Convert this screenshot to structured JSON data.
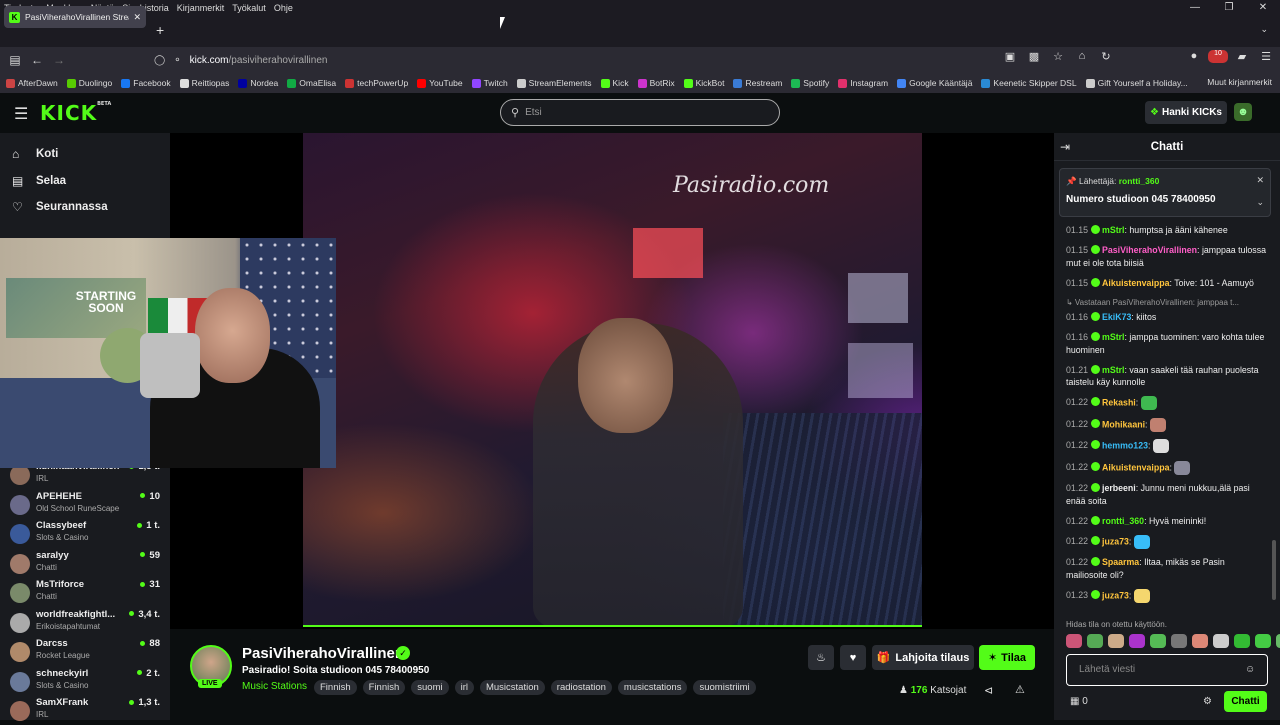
{
  "browser": {
    "menu": [
      "Tiedosto",
      "Muokkaa",
      "Näytä",
      "Sivuhistoria",
      "Kirjanmerkit",
      "Työkalut",
      "Ohje"
    ],
    "tab_title": "PasiViherahoVirallinen Stream",
    "url_host": "kick.com",
    "url_path": "/pasiviherahovirallinen",
    "badge_count": "10",
    "bookmarks": [
      {
        "label": "AfterDawn",
        "color": "#c44"
      },
      {
        "label": "Duolingo",
        "color": "#58cc02"
      },
      {
        "label": "Facebook",
        "color": "#1877f2"
      },
      {
        "label": "Reittiopas",
        "color": "#ddd"
      },
      {
        "label": "Nordea",
        "color": "#0000a0"
      },
      {
        "label": "OmaElisa",
        "color": "#1a4"
      },
      {
        "label": "techPowerUp",
        "color": "#c33"
      },
      {
        "label": "YouTube",
        "color": "#f00"
      },
      {
        "label": "Twitch",
        "color": "#9146ff"
      },
      {
        "label": "StreamElements",
        "color": "#ccc"
      },
      {
        "label": "Kick",
        "color": "#53fc18"
      },
      {
        "label": "BotRix",
        "color": "#c3c"
      },
      {
        "label": "KickBot",
        "color": "#53fc18"
      },
      {
        "label": "Restream",
        "color": "#3a7bd5"
      },
      {
        "label": "Spotify",
        "color": "#1db954"
      },
      {
        "label": "Instagram",
        "color": "#e1306c"
      },
      {
        "label": "Google Kääntäjä",
        "color": "#4285f4"
      },
      {
        "label": "Keenetic Skipper DSL",
        "color": "#2a8ad4"
      },
      {
        "label": "Gift Yourself a Holiday...",
        "color": "#ccc"
      }
    ],
    "other_bookmarks": "Muut kirjanmerkit"
  },
  "header": {
    "logo": "KICK",
    "logo_beta": "BETA",
    "search_placeholder": "Etsi",
    "get_kicks": "Hanki KICKs"
  },
  "sidebar": {
    "nav": [
      {
        "label": "Koti",
        "icon": "home-icon"
      },
      {
        "label": "Selaa",
        "icon": "browse-icon"
      },
      {
        "label": "Seurannassa",
        "icon": "heart-icon"
      }
    ],
    "channels": [
      {
        "name": "kuninaanvirallinen",
        "category": "IRL",
        "viewers": "1,3 t.",
        "color": "#8a6a5a"
      },
      {
        "name": "APEHEHE",
        "category": "Old School RuneScape",
        "viewers": "10",
        "color": "#6a6a8a"
      },
      {
        "name": "Classybeef",
        "category": "Slots & Casino",
        "viewers": "1 t.",
        "color": "#3a5a9a"
      },
      {
        "name": "saralyy",
        "category": "Chatti",
        "viewers": "59",
        "color": "#a07a6a"
      },
      {
        "name": "MsTriforce",
        "category": "Chatti",
        "viewers": "31",
        "color": "#7a8a6a"
      },
      {
        "name": "worldfreakfightl...",
        "category": "Erikoistapahtumat",
        "viewers": "3,4 t.",
        "color": "#aaa"
      },
      {
        "name": "Darcss",
        "category": "Rocket League",
        "viewers": "88",
        "color": "#b08a6a"
      },
      {
        "name": "schneckyirl",
        "category": "Slots & Casino",
        "viewers": "2 t.",
        "color": "#6a7a9a"
      },
      {
        "name": "SamXFrank",
        "category": "IRL",
        "viewers": "1,3 t.",
        "color": "#9a6a5a"
      }
    ]
  },
  "video": {
    "watermark": "Pasiradio.com",
    "webcam_poster": "STARTING SOON"
  },
  "stream": {
    "channel": "PasiViherahoVirallinen",
    "live": "LIVE",
    "title": "Pasiradio! Soita studioon 045 78400950",
    "category": "Music Stations",
    "tags": [
      "Finnish",
      "Finnish",
      "suomi",
      "irl",
      "Musicstation",
      "radiostation",
      "musicstations",
      "suomistriimi"
    ],
    "gift_sub": "Lahjoita tilaus",
    "subscribe": "Tilaa",
    "viewer_count": "176",
    "viewer_label": "Katsojat"
  },
  "chat": {
    "title": "Chatti",
    "pinned_label": "Lähettäjä",
    "pinned_user": "rontti_360",
    "pinned_message": "Numero studioon 045 78400950",
    "messages": [
      {
        "time": "01.15",
        "user": "mStrl",
        "color": "#53fc18",
        "text": "humptsa ja ääni kähenee"
      },
      {
        "time": "01.15",
        "user": "PasiViherahoVirallinen",
        "color": "#ff5ec8",
        "text": "jamppaa tulossa mut ei ole tota biisiä"
      },
      {
        "time": "01.15",
        "user": "Aikuistenvaippa",
        "color": "#ffc53d",
        "text": "Toive: 101 - Aamuyö"
      },
      {
        "reply": "Vastataan PasiViherahoVirallinen: jamppaa t..."
      },
      {
        "time": "01.16",
        "user": "EkiK73",
        "color": "#38bdf8",
        "text": "kiitos"
      },
      {
        "time": "01.16",
        "user": "mStrl",
        "color": "#53fc18",
        "text": "jamppa tuominen: varo kohta tulee huominen"
      },
      {
        "time": "01.21",
        "user": "mStrl",
        "color": "#53fc18",
        "text": "vaan saakeli tää rauhan puolesta taistelu käy kunnolle"
      },
      {
        "time": "01.22",
        "user": "Rekashi",
        "color": "#ffc53d",
        "text": "",
        "emote": "#3fb950"
      },
      {
        "time": "01.22",
        "user": "Mohikaani",
        "color": "#ffc53d",
        "text": "",
        "emote": "#c08070"
      },
      {
        "time": "01.22",
        "user": "hemmo123",
        "color": "#38bdf8",
        "text": "",
        "emote": "#ddd"
      },
      {
        "time": "01.22",
        "user": "Aikuistenvaippa",
        "color": "#ffc53d",
        "text": "",
        "emote": "#889"
      },
      {
        "time": "01.22",
        "user": "jerbeeni",
        "color": "#eee",
        "text": "Junnu meni nukkuu,älä pasi enää soita"
      },
      {
        "time": "01.22",
        "user": "rontti_360",
        "color": "#53fc18",
        "text": "Hyvä meininki!"
      },
      {
        "time": "01.22",
        "user": "juza73",
        "color": "#ffc53d",
        "text": "",
        "emote": "#38bdf8"
      },
      {
        "time": "01.22",
        "user": "Spaarma",
        "color": "#ffc53d",
        "text": "Iltaa, mikäs se Pasin mailiosoite oli?"
      },
      {
        "time": "01.23",
        "user": "juza73",
        "color": "#ffc53d",
        "text": "",
        "emote": "#f5d76e"
      }
    ],
    "slow_mode": "Hidas tila on otettu käyttöön.",
    "input_placeholder": "Lähetä viesti",
    "points": "0",
    "send": "Chatti"
  }
}
